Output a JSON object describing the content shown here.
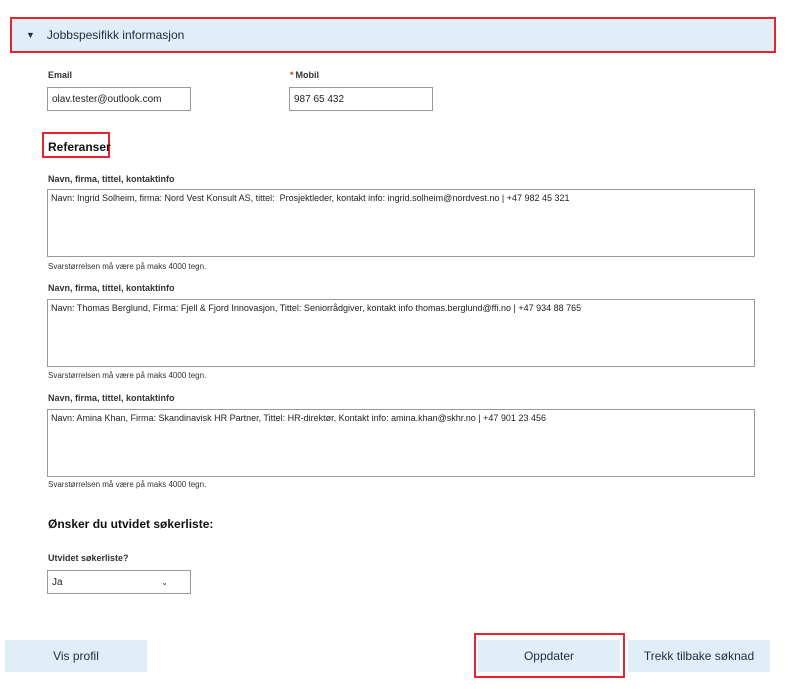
{
  "section": {
    "title": "Jobbspesifikk informasjon",
    "chevron_icon": "chevron-down-icon"
  },
  "contact": {
    "email_label": "Email",
    "email_value": "olav.tester@outlook.com",
    "mobile_required_marker": "*",
    "mobile_label": "Mobil",
    "mobile_value": "987 65 432"
  },
  "references": {
    "title": "Referanser",
    "items": [
      {
        "label": "Navn, firma, tittel, kontaktinfo",
        "value": "Navn: Ingrid Solheim, firma: Nord Vest Konsult AS, tittel:  Prosjektleder, kontakt info: ingrid.solheim@nordvest.no | +47 982 45 321",
        "hint": "Svarstørrelsen må være på maks 4000 tegn."
      },
      {
        "label": "Navn, firma, tittel, kontaktinfo",
        "value": "Navn: Thomas Berglund, Firma: Fjell & Fjord Innovasjon, Tittel: Seniorrådgiver, kontakt info thomas.berglund@ffi.no | +47 934 88 765",
        "hint": "Svarstørrelsen må være på maks 4000 tegn."
      },
      {
        "label": "Navn, firma, tittel, kontaktinfo",
        "value": "Navn: Amina Khan, Firma: Skandinavisk HR Partner, Tittel: HR-direktør, Kontakt info: amina.khan@skhr.no | +47 901 23 456",
        "hint": "Svarstørrelsen må være på maks 4000 tegn."
      }
    ]
  },
  "extended": {
    "heading": "Ønsker du utvidet søkerliste:",
    "label": "Utvidet søkerliste?",
    "selected": "Ja"
  },
  "buttons": {
    "view_profile": "Vis profil",
    "update": "Oppdater",
    "withdraw": "Trekk tilbake søknad"
  },
  "colors": {
    "accent_blue_bg": "#e2eef7",
    "highlight_red": "#e3262c"
  }
}
